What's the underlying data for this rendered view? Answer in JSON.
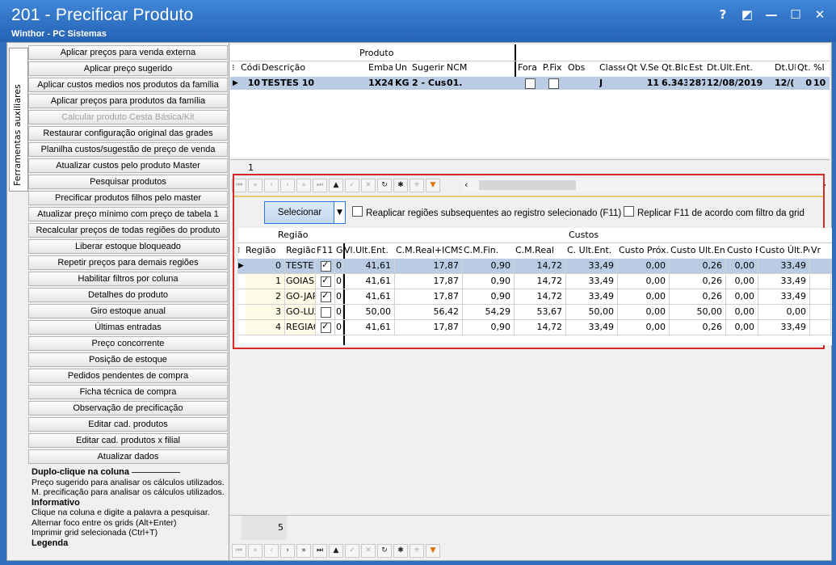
{
  "window": {
    "title": "201 - Precificar Produto",
    "subtitle": "Winthor - PC Sistemas",
    "buttons": {
      "help": "?",
      "restore": "◩",
      "minimize": "—",
      "maximize": "☐",
      "close": "✕"
    }
  },
  "side_tab": {
    "label": "Ferramentas auxiliares"
  },
  "tools": [
    {
      "label": "Aplicar preços para venda externa",
      "enabled": true
    },
    {
      "label": "Aplicar preço sugerido",
      "enabled": true
    },
    {
      "label": "Aplicar custos medios nos produtos da família",
      "enabled": true
    },
    {
      "label": "Aplicar preços para produtos da família",
      "enabled": true
    },
    {
      "label": "Calcular produto Cesta Básica/Kit",
      "enabled": false
    },
    {
      "label": "Restaurar configuração original das grades",
      "enabled": true
    },
    {
      "label": "Planilha custos/sugestão de preço de venda",
      "enabled": true
    },
    {
      "label": "Atualizar custos pelo produto Master",
      "enabled": true
    },
    {
      "label": "Pesquisar produtos",
      "enabled": true
    },
    {
      "label": "Precificar produtos filhos pelo master",
      "enabled": true
    },
    {
      "label": "Atualizar preço mínimo com preço de tabela 1",
      "enabled": true
    },
    {
      "label": "Recalcular preços de todas regiões do produto",
      "enabled": true
    },
    {
      "label": "Liberar estoque bloqueado",
      "enabled": true
    },
    {
      "label": "Repetir preços para demais regiões",
      "enabled": true
    },
    {
      "label": "Habilitar filtros por coluna",
      "enabled": true
    },
    {
      "label": "Detalhes do produto",
      "enabled": true
    },
    {
      "label": "Giro estoque anual",
      "enabled": true
    },
    {
      "label": "Últimas entradas",
      "enabled": true
    },
    {
      "label": "Preço concorrente",
      "enabled": true
    },
    {
      "label": "Posição de estoque",
      "enabled": true
    },
    {
      "label": "Pedidos pendentes de compra",
      "enabled": true
    },
    {
      "label": "Ficha técnica de compra",
      "enabled": true
    },
    {
      "label": "Observação de precificação",
      "enabled": true
    },
    {
      "label": "Editar cad. produtos",
      "enabled": true
    },
    {
      "label": "Editar cad. produtos x filial",
      "enabled": true
    },
    {
      "label": "Atualizar dados",
      "enabled": true
    }
  ],
  "info": {
    "title1": "Duplo-clique na coluna",
    "line1": "Preço sugerido para analisar os cálculos utilizados.",
    "line2": "M. precificação para analisar os cálculos utilizados.",
    "title2": "Informativo",
    "line3": "Clique na coluna e digite a palavra a pesquisar.",
    "line4": "Alternar foco entre os grids (Alt+Enter)",
    "line5": "Imprimir grid selecionada (Ctrl+T)",
    "title3": "Legenda"
  },
  "product_grid": {
    "group_label": "Produto",
    "headers": [
      "Códi",
      "Descrição",
      "Emba",
      "Un",
      "Sugerir",
      "NCM",
      "Fora d",
      "P.Fix",
      "Obs",
      "Classe",
      "Qt V.Se",
      "Qt.Blo",
      "Est",
      "Dt.Ult.Ent.",
      "Dt.Ul",
      "Qt.",
      "%I"
    ],
    "row": {
      "codigo": "10",
      "descricao": "TESTES 10",
      "emba": "1X24",
      "un": "KG",
      "sugerir": "2 - Cus",
      "ncm": "01.",
      "fora": false,
      "pfix": false,
      "obs": "",
      "classe": "J",
      "qtvse": "11",
      "qtblo": "6.343",
      "est": "287",
      "dtult": "12/08/2019",
      "dtul2": "12/(",
      "qt": "0",
      "pi": "10"
    },
    "footer_count": "1"
  },
  "region_section": {
    "select_button": "Selecionar",
    "check1": "Reaplicar regiões subsequentes ao registro selecionado (F11)",
    "check2": "Replicar F11 de acordo com filtro da grid",
    "group_region": "Região",
    "group_costs": "Custos",
    "headers": [
      "Região",
      "Região",
      "F11",
      "G",
      "Vl.Ult.Ent.",
      "C.M.Real+ICMS",
      "C.M.Fin.",
      "C.M.Real",
      "C. Ult.Ent.",
      "Custo Próx.",
      "Custo Ult.Ent",
      "Custo F",
      "Custo Últ.Pe",
      "Vr"
    ],
    "rows": [
      {
        "num": "0",
        "name": "TESTE",
        "f11": true,
        "g": "0",
        "vlult": "41,61",
        "cmicms": "17,87",
        "cmfin": "0,90",
        "cmreal": "14,72",
        "cult": "33,49",
        "prox": "0,00",
        "custoult": "0,26",
        "custof": "0,00",
        "ultpe": "33,49"
      },
      {
        "num": "1",
        "name": "GOIAS",
        "f11": true,
        "g": "0",
        "vlult": "41,61",
        "cmicms": "17,87",
        "cmfin": "0,90",
        "cmreal": "14,72",
        "cult": "33,49",
        "prox": "0,00",
        "custoult": "0,26",
        "custof": "0,00",
        "ultpe": "33,49"
      },
      {
        "num": "2",
        "name": "GO-JAR",
        "f11": true,
        "g": "0",
        "vlult": "41,61",
        "cmicms": "17,87",
        "cmfin": "0,90",
        "cmreal": "14,72",
        "cult": "33,49",
        "prox": "0,00",
        "custoult": "0,26",
        "custof": "0,00",
        "ultpe": "33,49"
      },
      {
        "num": "3",
        "name": "GO-LUZ",
        "f11": false,
        "g": "0",
        "vlult": "50,00",
        "cmicms": "56,42",
        "cmfin": "54,29",
        "cmreal": "53,67",
        "cult": "50,00",
        "prox": "0,00",
        "custoult": "50,00",
        "custof": "0,00",
        "ultpe": "0,00"
      },
      {
        "num": "4",
        "name": "REGIAO",
        "f11": true,
        "g": "0",
        "vlult": "41,61",
        "cmicms": "17,87",
        "cmfin": "0,90",
        "cmreal": "14,72",
        "cult": "33,49",
        "prox": "0,00",
        "custoult": "0,26",
        "custof": "0,00",
        "ultpe": "33,49"
      }
    ],
    "footer_count": "5"
  },
  "colors": {
    "title_bar": "#2f6fbe",
    "selected_row": "#b9cce4",
    "highlight_border": "#d82828",
    "filter_icon": "#e07000"
  }
}
